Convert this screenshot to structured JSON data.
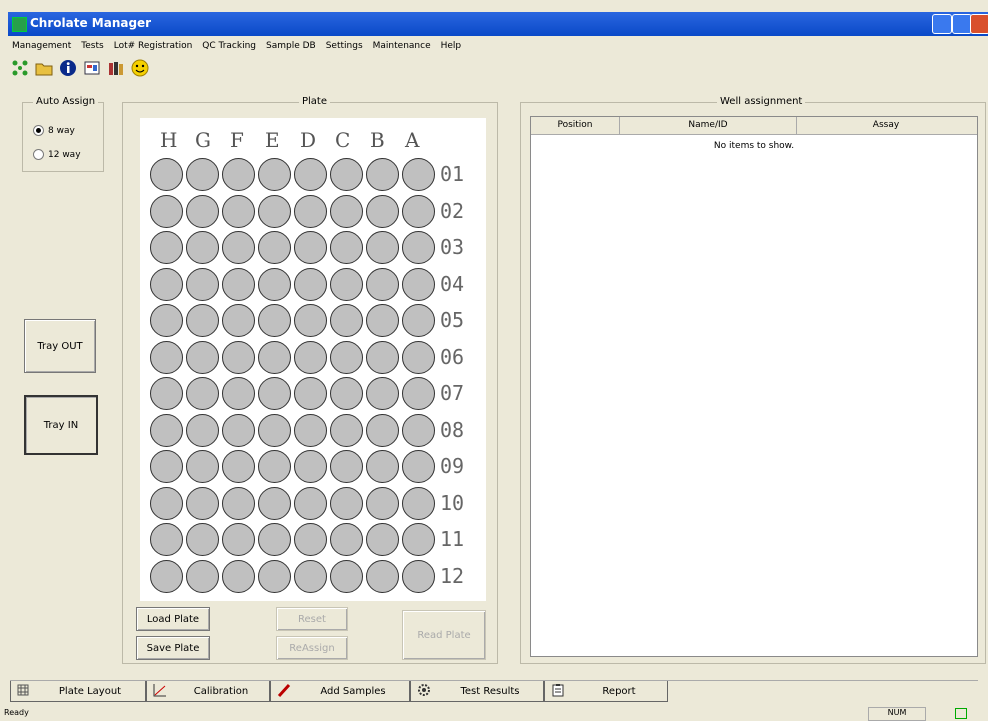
{
  "app": {
    "title": "Chrolate Manager"
  },
  "menu": [
    "Management",
    "Tests",
    "Lot# Registration",
    "QC Tracking",
    "Sample DB",
    "Settings",
    "Maintenance",
    "Help"
  ],
  "toolbar": {
    "icons": [
      "network-icon",
      "open-folder-icon",
      "info-icon",
      "reports-icon",
      "books-icon",
      "smiley-icon"
    ]
  },
  "auto_assign": {
    "label": "Auto Assign",
    "options": [
      "8 way",
      "12 way"
    ],
    "selected": "8 way"
  },
  "tray": {
    "out_label": "Tray OUT",
    "in_label": "Tray IN"
  },
  "plate": {
    "label": "Plate",
    "columns": [
      "H",
      "G",
      "F",
      "E",
      "D",
      "C",
      "B",
      "A"
    ],
    "rows": [
      "01",
      "02",
      "03",
      "04",
      "05",
      "06",
      "07",
      "08",
      "09",
      "10",
      "11",
      "12"
    ]
  },
  "plate_buttons": {
    "load": "Load Plate",
    "save": "Save Plate",
    "reset": "Reset",
    "reassign": "ReAssign",
    "read": "Read Plate"
  },
  "well_assignment": {
    "label": "Well assignment",
    "columns": [
      "Position",
      "Name/ID",
      "Assay"
    ],
    "empty_message": "No items to show."
  },
  "tabs": [
    {
      "label": "Plate Layout",
      "icon": "grid-icon"
    },
    {
      "label": "Calibration",
      "icon": "chart-line-icon"
    },
    {
      "label": "Add Samples",
      "icon": "pen-icon"
    },
    {
      "label": "Test Results",
      "icon": "gear-icon"
    },
    {
      "label": "Report",
      "icon": "clipboard-icon"
    }
  ],
  "status": {
    "text": "Ready",
    "num_lock": "NUM"
  }
}
